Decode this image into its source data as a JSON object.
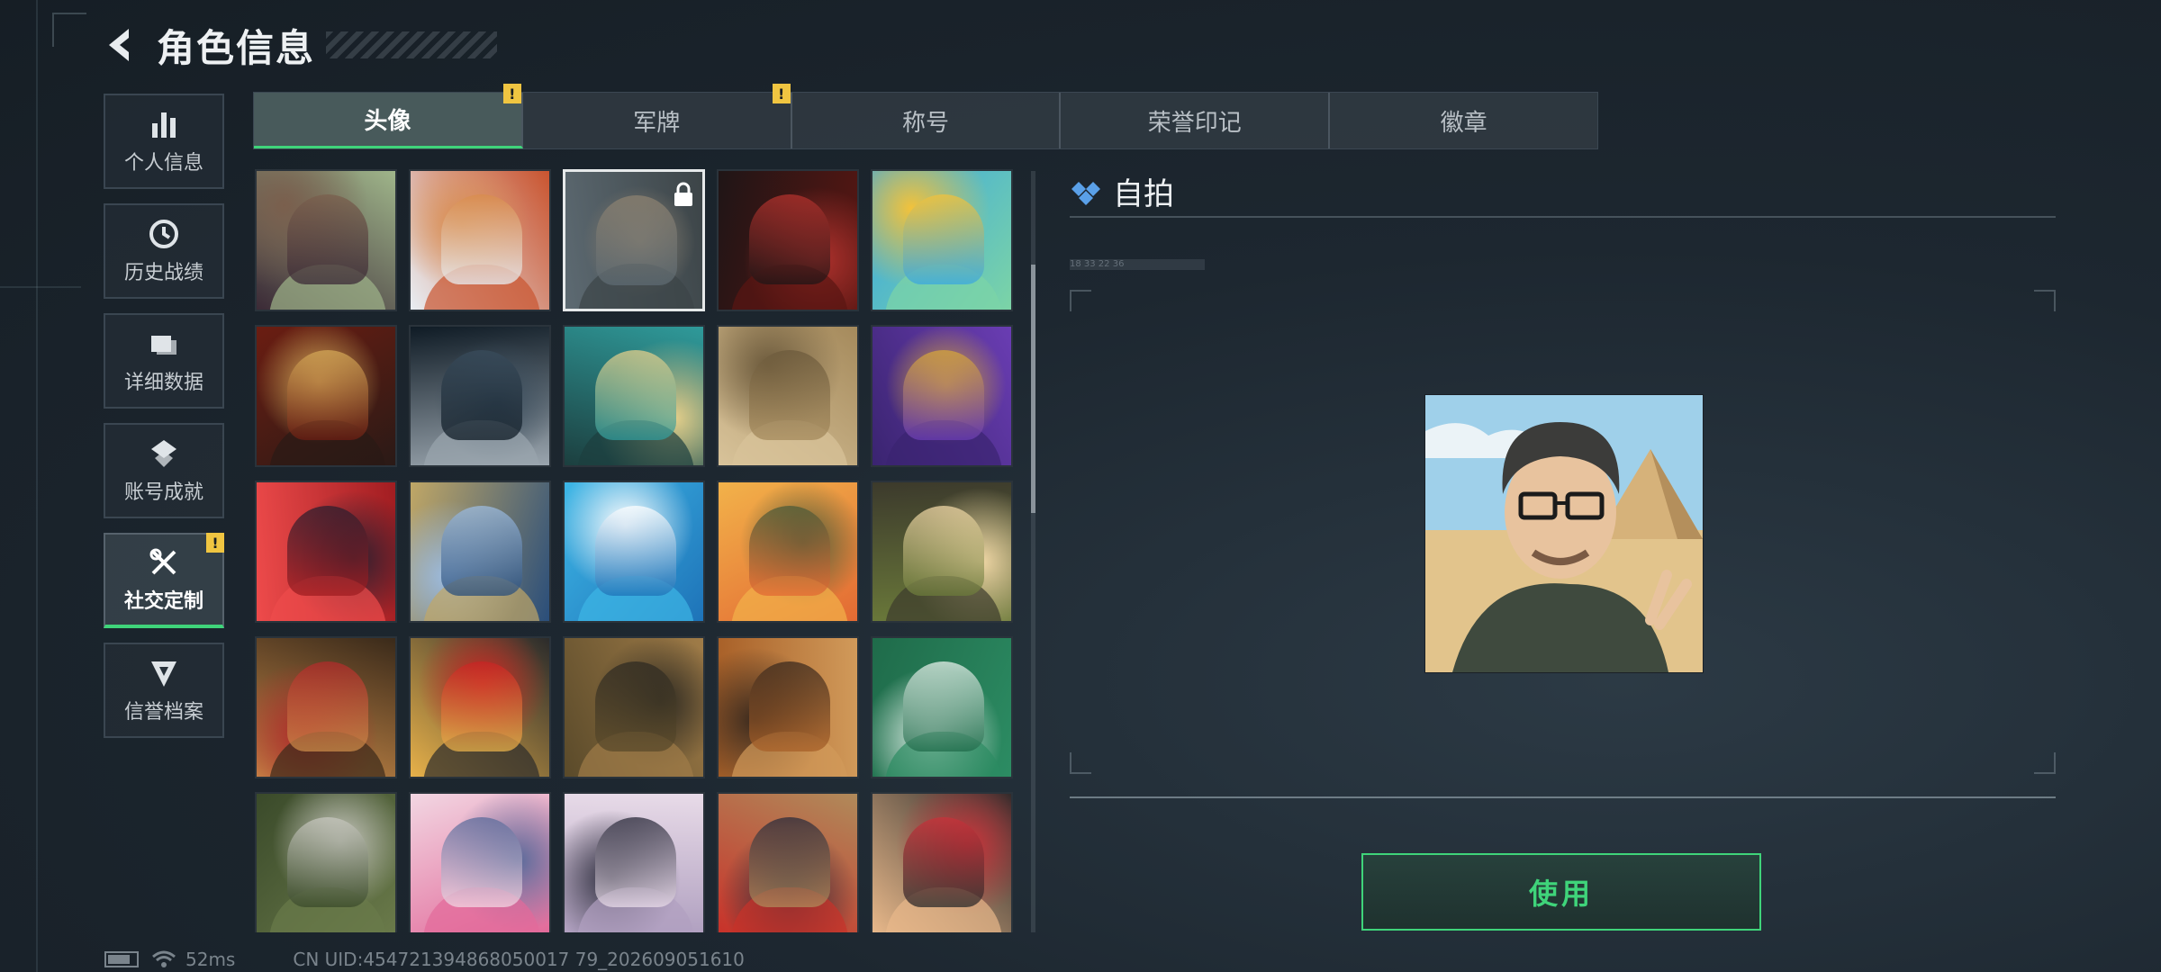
{
  "header": {
    "title": "角色信息"
  },
  "sidebar": {
    "items": [
      {
        "label": "个人信息",
        "icon": "bar-chart-icon",
        "active": false,
        "alert": ""
      },
      {
        "label": "历史战绩",
        "icon": "clock-icon",
        "active": false,
        "alert": ""
      },
      {
        "label": "详细数据",
        "icon": "folder-icon",
        "active": false,
        "alert": ""
      },
      {
        "label": "账号成就",
        "icon": "achievement-icon",
        "active": false,
        "alert": ""
      },
      {
        "label": "社交定制",
        "icon": "tools-icon",
        "active": true,
        "alert": "!"
      },
      {
        "label": "信誉档案",
        "icon": "credit-badge-icon",
        "active": false,
        "alert": ""
      }
    ]
  },
  "tabs": [
    {
      "label": "头像",
      "active": true,
      "alert": "!"
    },
    {
      "label": "军牌",
      "active": false,
      "alert": "!"
    },
    {
      "label": "称号",
      "active": false,
      "alert": ""
    },
    {
      "label": "荣誉印记",
      "active": false,
      "alert": ""
    },
    {
      "label": "徽章",
      "active": false,
      "alert": ""
    }
  ],
  "avatars": [
    {
      "name": "avatar-1",
      "colors": [
        "#3b2a36",
        "#7a5f4d",
        "#9fb58a"
      ]
    },
    {
      "name": "avatar-2",
      "colors": [
        "#e8eef3",
        "#d98c4c",
        "#c9542f"
      ]
    },
    {
      "name": "avatar-3",
      "colors": [
        "#5d6a72",
        "#8c8170",
        "#3c4447"
      ],
      "selected": true,
      "locked": true
    },
    {
      "name": "avatar-4",
      "colors": [
        "#1f1516",
        "#b3322d",
        "#5a1612"
      ]
    },
    {
      "name": "avatar-5",
      "colors": [
        "#3aa7e0",
        "#f2c23b",
        "#7cd4a6"
      ]
    },
    {
      "name": "avatar-6",
      "colors": [
        "#6b1d12",
        "#d4a857",
        "#2a1a16"
      ]
    },
    {
      "name": "avatar-7",
      "colors": [
        "#0f1b25",
        "#394c5c",
        "#9aa5ae"
      ]
    },
    {
      "name": "avatar-8",
      "colors": [
        "#2f9a9a",
        "#e5cf8a",
        "#1c3f3f"
      ]
    },
    {
      "name": "avatar-9",
      "colors": [
        "#a58a5c",
        "#6c5a3c",
        "#d8c39a"
      ]
    },
    {
      "name": "avatar-10",
      "colors": [
        "#6a3db3",
        "#d6a63a",
        "#3a2470"
      ]
    },
    {
      "name": "avatar-11",
      "colors": [
        "#a11d21",
        "#2b1e2e",
        "#ee4b4b"
      ]
    },
    {
      "name": "avatar-12",
      "colors": [
        "#2a4e7a",
        "#9dbce0",
        "#c0a766"
      ]
    },
    {
      "name": "avatar-13",
      "colors": [
        "#1e73b8",
        "#ffffff",
        "#3db6e6"
      ]
    },
    {
      "name": "avatar-14",
      "colors": [
        "#e36a33",
        "#4a5a38",
        "#f2b24a"
      ]
    },
    {
      "name": "avatar-15",
      "colors": [
        "#6b7a3a",
        "#f0d7a6",
        "#3c3a2c"
      ]
    },
    {
      "name": "avatar-16",
      "colors": [
        "#c98a48",
        "#b02a2a",
        "#3a2a1a"
      ]
    },
    {
      "name": "avatar-17",
      "colors": [
        "#e7b14a",
        "#c82323",
        "#2b2b2b"
      ]
    },
    {
      "name": "avatar-18",
      "colors": [
        "#5a4a2a",
        "#2e2a22",
        "#a07c48"
      ]
    },
    {
      "name": "avatar-19",
      "colors": [
        "#a86028",
        "#3b2a1e",
        "#d19a5a"
      ]
    },
    {
      "name": "avatar-20",
      "colors": [
        "#1f6b4a",
        "#e8f2ec",
        "#2c8c63"
      ]
    },
    {
      "name": "avatar-21",
      "colors": [
        "#3a4a2a",
        "#c8c8c0",
        "#6a7a4a"
      ]
    },
    {
      "name": "avatar-22",
      "colors": [
        "#f2d6e2",
        "#5a6a9a",
        "#e26a9a"
      ]
    },
    {
      "name": "avatar-23",
      "colors": [
        "#e8dbe8",
        "#2a2a3a",
        "#b0a0c0"
      ]
    },
    {
      "name": "avatar-24",
      "colors": [
        "#b08a5a",
        "#2a2a3a",
        "#c8322a"
      ]
    },
    {
      "name": "avatar-25",
      "colors": [
        "#2a2a2a",
        "#c8323a",
        "#e8b88a"
      ]
    }
  ],
  "detail": {
    "title": "自拍",
    "subtitle": "18 33   22 36",
    "preview_colors": [
      "#9fd0ea",
      "#e2c48c",
      "#3f4a3e"
    ]
  },
  "use_button": {
    "label": "使用"
  },
  "status": {
    "battery_level": 0.8,
    "ping": "52ms",
    "uid": "CN UID:454721394868050017 79_202609051610"
  },
  "colors": {
    "accent": "#3fd47a",
    "alert": "#f0c541"
  }
}
